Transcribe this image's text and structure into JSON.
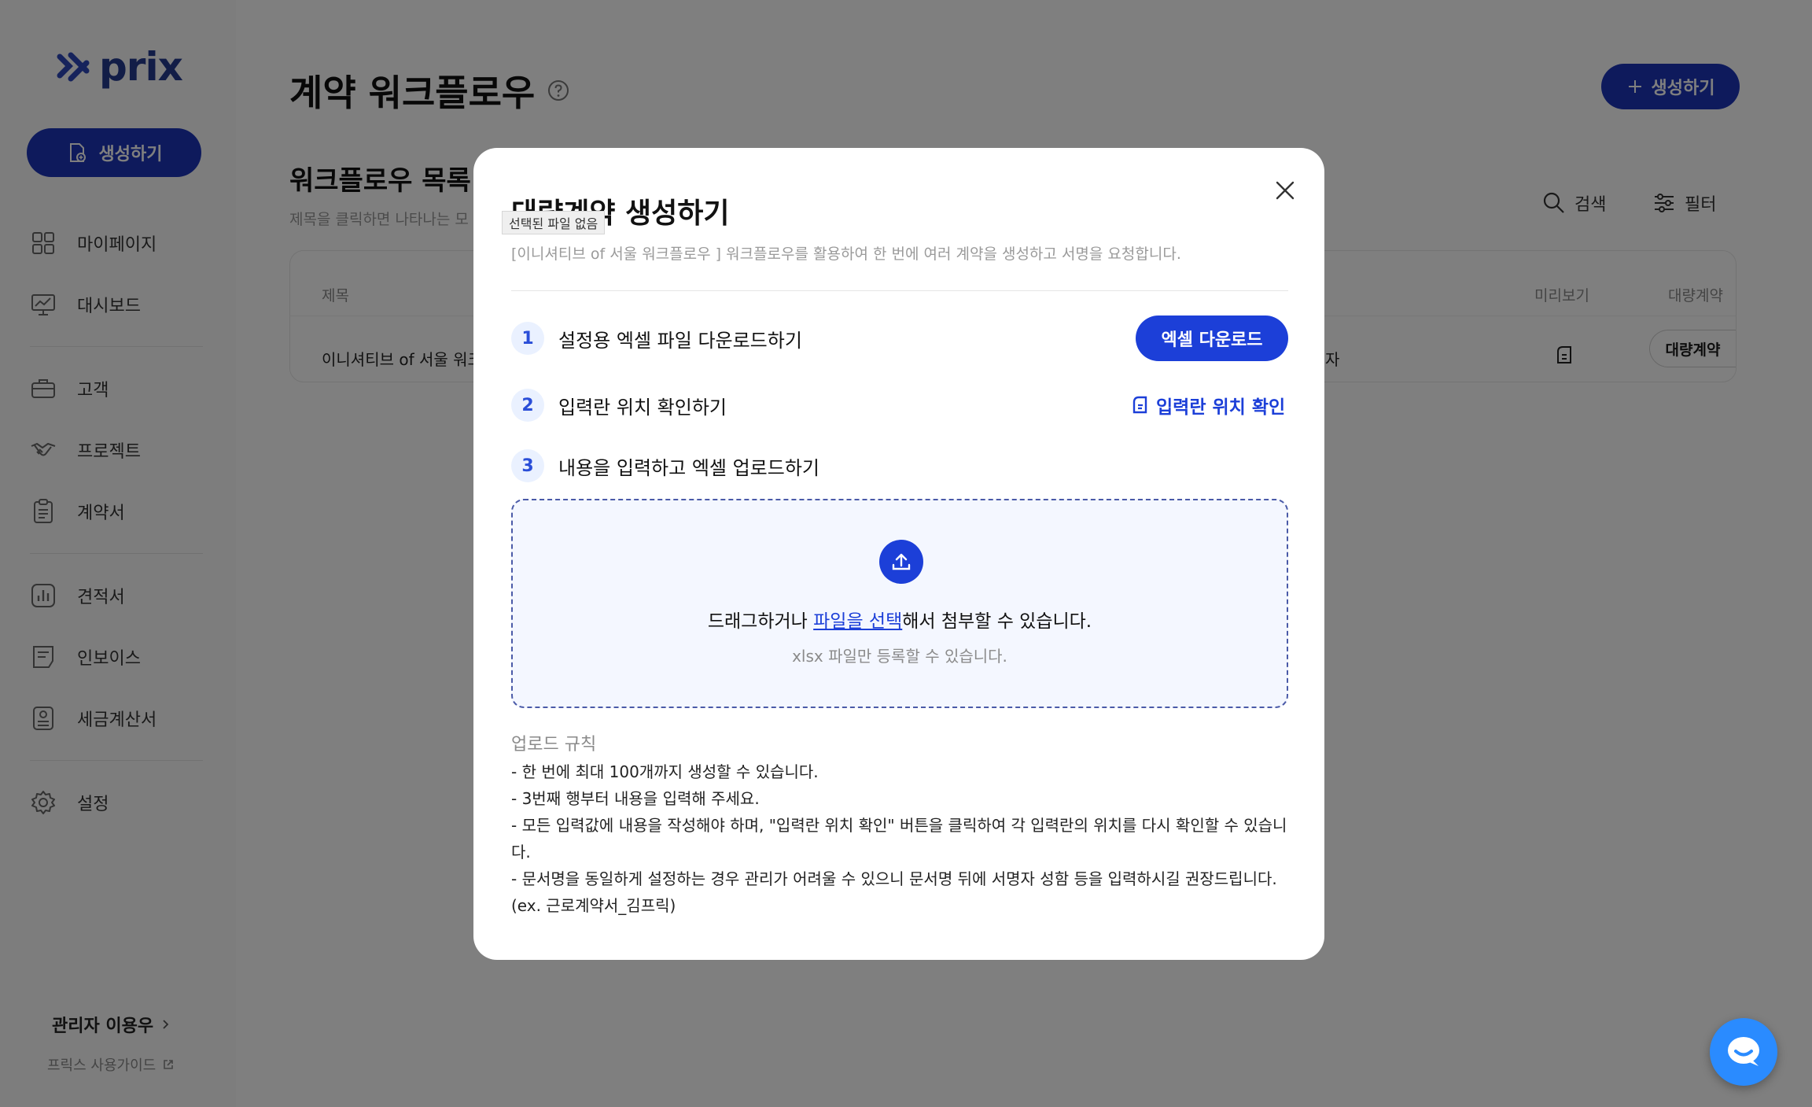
{
  "brand": {
    "name": "prix",
    "color": "#1c35b8"
  },
  "sidebar": {
    "create_label": "생성하기",
    "items": [
      {
        "label": "마이페이지",
        "icon": "grid-icon"
      },
      {
        "label": "대시보드",
        "icon": "chart-board-icon"
      },
      {
        "label": "고객",
        "icon": "briefcase-icon"
      },
      {
        "label": "프로젝트",
        "icon": "handshake-icon"
      },
      {
        "label": "계약서",
        "icon": "clipboard-icon"
      },
      {
        "label": "견적서",
        "icon": "bar-chart-icon"
      },
      {
        "label": "인보이스",
        "icon": "receipt-icon"
      },
      {
        "label": "세금계산서",
        "icon": "tax-document-icon"
      },
      {
        "label": "설정",
        "icon": "gear-icon"
      }
    ],
    "admin_label": "관리자 이용우",
    "guide_label": "프릭스 사용가이드"
  },
  "main": {
    "title": "계약 워크플로우",
    "create_label": "생성하기",
    "list_title": "워크플로우 목록",
    "list_sub": "제목을 클릭하면 나타나는 모",
    "search_label": "검색",
    "filter_label": "필터",
    "table": {
      "col_title": "제목",
      "col_preview": "미리보기",
      "col_bulk": "대량계약",
      "row_title": "이니셔티브 of 서울 워크",
      "row_partial": "자",
      "row_bulk": "대량계약"
    }
  },
  "modal": {
    "title": "대량계약 생성하기",
    "tooltip": "선택된 파일 없음",
    "description": "[이니셔티브 of 서울 워크플로우 ] 워크플로우를 활용하여 한 번에 여러 계약을 생성하고 서명을 요청합니다.",
    "steps": [
      {
        "num": "1",
        "label": "설정용 엑셀 파일 다운로드하기"
      },
      {
        "num": "2",
        "label": "입력란 위치 확인하기"
      },
      {
        "num": "3",
        "label": "내용을 입력하고 엑셀 업로드하기"
      }
    ],
    "excel_download_label": "엑셀 다운로드",
    "position_check_label": "입력란 위치 확인",
    "drop_before": "드래그하거나 ",
    "drop_link": "파일을 선택",
    "drop_after": "해서 첨부할 수 있습니다.",
    "drop_sub": "xlsx 파일만 등록할 수 있습니다.",
    "rules_title": "업로드 규칙",
    "rules": [
      "- 한 번에 최대 100개까지 생성할 수 있습니다.",
      "- 3번째 행부터 내용을 입력해 주세요.",
      "- 모든 입력값에 내용을 작성해야 하며, \"입력란 위치 확인\" 버튼을 클릭하여 각 입력란의 위치를 다시 확인할 수 있습니다.",
      "- 문서명을 동일하게 설정하는 경우 관리가 어려울 수 있으니 문서명 뒤에 서명자 성함 등을 입력하시길 권장드립니다. (ex. 근로계약서_김프릭)"
    ]
  }
}
